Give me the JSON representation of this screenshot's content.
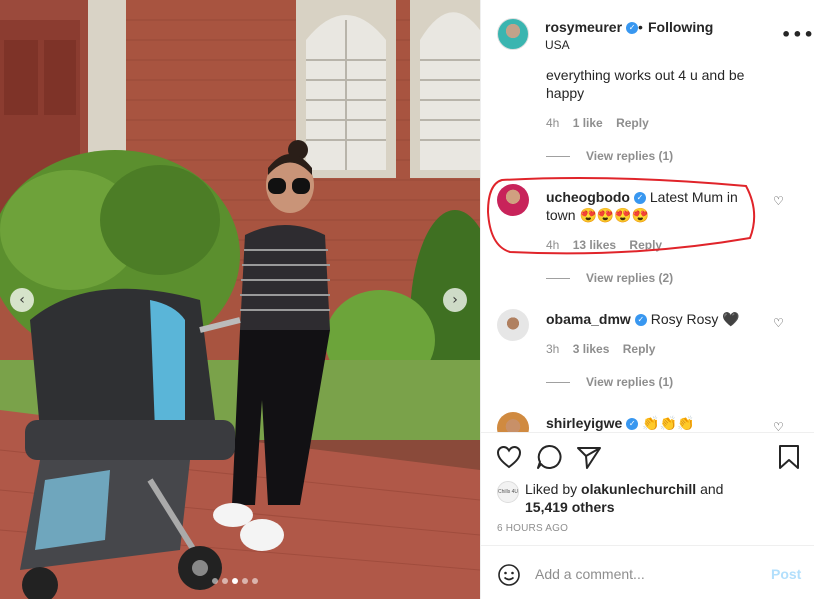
{
  "post": {
    "author": "rosymeurer",
    "separator": "•",
    "follow_status": "Following",
    "location": "USA",
    "more_icon": "more-icon"
  },
  "carousel": {
    "prev_icon": "chevron-left-icon",
    "next_icon": "chevron-right-icon",
    "prev_glyph": "‹",
    "next_glyph": "›",
    "slide_count": 5,
    "active_index": 2
  },
  "comments": [
    {
      "text": "everything works out 4 u and be happy",
      "time": "4h",
      "likes": "1 like",
      "reply": "Reply",
      "view_replies": "View replies (1)"
    },
    {
      "author": "ucheogbodo",
      "text": "Latest Mum in town 😍😍😍😍",
      "time": "4h",
      "likes": "13 likes",
      "reply": "Reply",
      "view_replies": "View replies (2)"
    },
    {
      "author": "obama_dmw",
      "text": "Rosy Rosy 🖤",
      "time": "3h",
      "likes": "3 likes",
      "reply": "Reply",
      "view_replies": "View replies (1)"
    },
    {
      "author": "shirleyigwe",
      "text": "👏👏👏"
    }
  ],
  "engagement": {
    "liked_by_prefix": "Liked by",
    "liked_by_user": "olakunlechurchill",
    "liked_by_and": "and",
    "others": "15,419 others",
    "time_ago": "6 HOURS AGO",
    "liker_avatar_text": "Chills 4U"
  },
  "comment_box": {
    "placeholder": "Add a comment...",
    "post_label": "Post"
  },
  "colors": {
    "verified": "#3897f0",
    "highlight": "#e0242a",
    "muted": "#8e8e8e",
    "post_disabled": "#b2dffc"
  }
}
